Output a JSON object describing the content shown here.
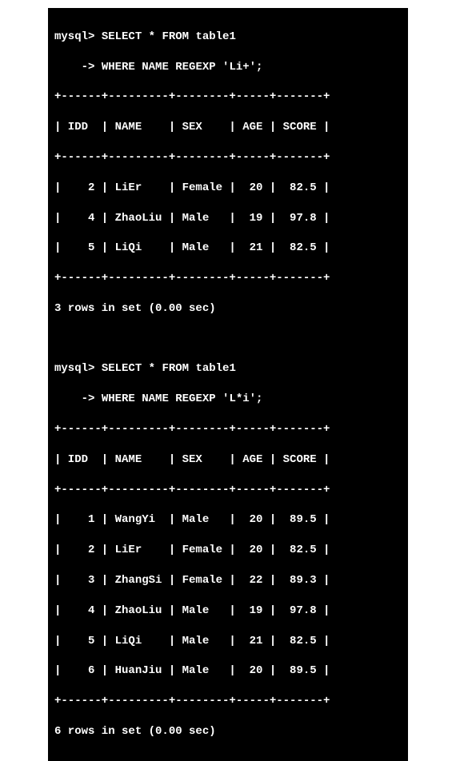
{
  "query1": {
    "prompt": "mysql>",
    "line1": "SELECT * FROM table1",
    "cont": "    ->",
    "line2": "WHERE NAME REGEXP 'Li+';",
    "border": "+------+---------+--------+-----+-------+",
    "header": "| IDD  | NAME    | SEX    | AGE | SCORE |",
    "rows": [
      "|    2 | LiEr    | Female |  20 |  82.5 |",
      "|    4 | ZhaoLiu | Male   |  19 |  97.8 |",
      "|    5 | LiQi    | Male   |  21 |  82.5 |"
    ],
    "summary": "3 rows in set (0.00 sec)"
  },
  "query2": {
    "prompt": "mysql>",
    "line1": "SELECT * FROM table1",
    "cont": "    ->",
    "line2": "WHERE NAME REGEXP 'L*i';",
    "border": "+------+---------+--------+-----+-------+",
    "header": "| IDD  | NAME    | SEX    | AGE | SCORE |",
    "rows": [
      "|    1 | WangYi  | Male   |  20 |  89.5 |",
      "|    2 | LiEr    | Female |  20 |  82.5 |",
      "|    3 | ZhangSi | Female |  22 |  89.3 |",
      "|    4 | ZhaoLiu | Male   |  19 |  97.8 |",
      "|    5 | LiQi    | Male   |  21 |  82.5 |",
      "|    6 | HuanJiu | Male   |  20 |  89.5 |"
    ],
    "summary": "6 rows in set (0.00 sec)"
  }
}
